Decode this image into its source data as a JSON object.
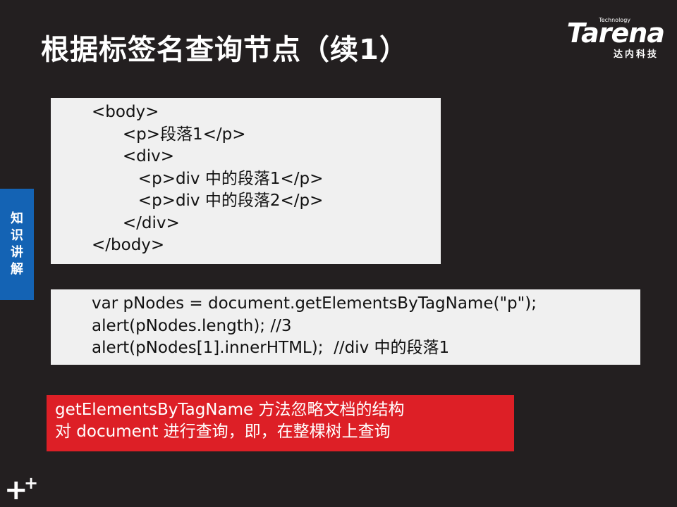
{
  "slide": {
    "title": "根据标签名查询节点（续1）"
  },
  "logo": {
    "tagline": "Technology",
    "brand": "Tarena",
    "subtitle": "达内科技"
  },
  "side_tab": {
    "chars": [
      "知",
      "识",
      "讲",
      "解"
    ]
  },
  "code_block_1": {
    "lines": [
      "<body>",
      "      <p>段落1</p>",
      "      <div>",
      "         <p>div 中的段落1</p>",
      "         <p>div 中的段落2</p>",
      "      </div>",
      "</body>"
    ]
  },
  "code_block_2": {
    "lines": [
      "var pNodes = document.getElementsByTagName(\"p\");",
      "alert(pNodes.length); //3",
      "alert(pNodes[1].innerHTML);  //div 中的段落1"
    ]
  },
  "note": {
    "lines": [
      "getElementsByTagName 方法忽略文档的结构",
      "对 document 进行查询，即，在整棵树上查询"
    ]
  },
  "colors": {
    "background": "#231f20",
    "side_tab": "#1463b4",
    "note": "#dd1f26",
    "code_box": "#f0f0f0"
  }
}
